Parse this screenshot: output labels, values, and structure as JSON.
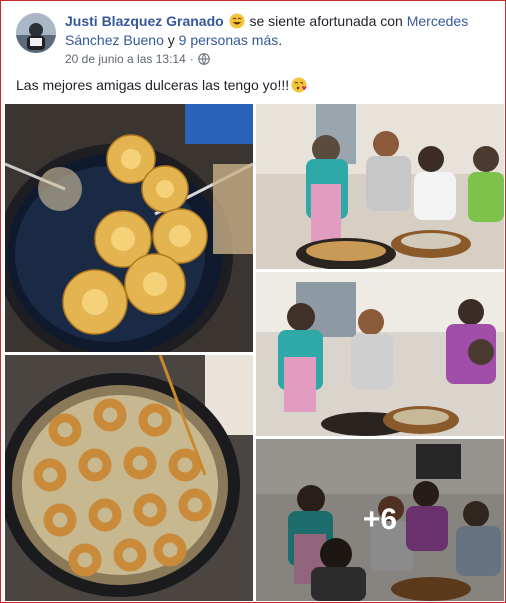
{
  "post": {
    "author": "Justi Blazquez Granado",
    "feeling_text": "se siente afortunada con",
    "tagged_1": "Mercedes Sánchez Bueno",
    "conjunction": "y",
    "others": "9 personas más",
    "period": ".",
    "date": "20 de junio a las 13:14",
    "separator": "·",
    "privacy_icon": "globe-icon",
    "feeling_icon": "smiling-face-icon",
    "message": "Las mejores amigas dulceras las tengo yo!!!",
    "message_emoji": "face-blowing-kiss-icon"
  },
  "photos": {
    "more_count": "+6"
  },
  "colors": {
    "link": "#365899",
    "meta": "#616770",
    "border": "#c62a2a"
  }
}
